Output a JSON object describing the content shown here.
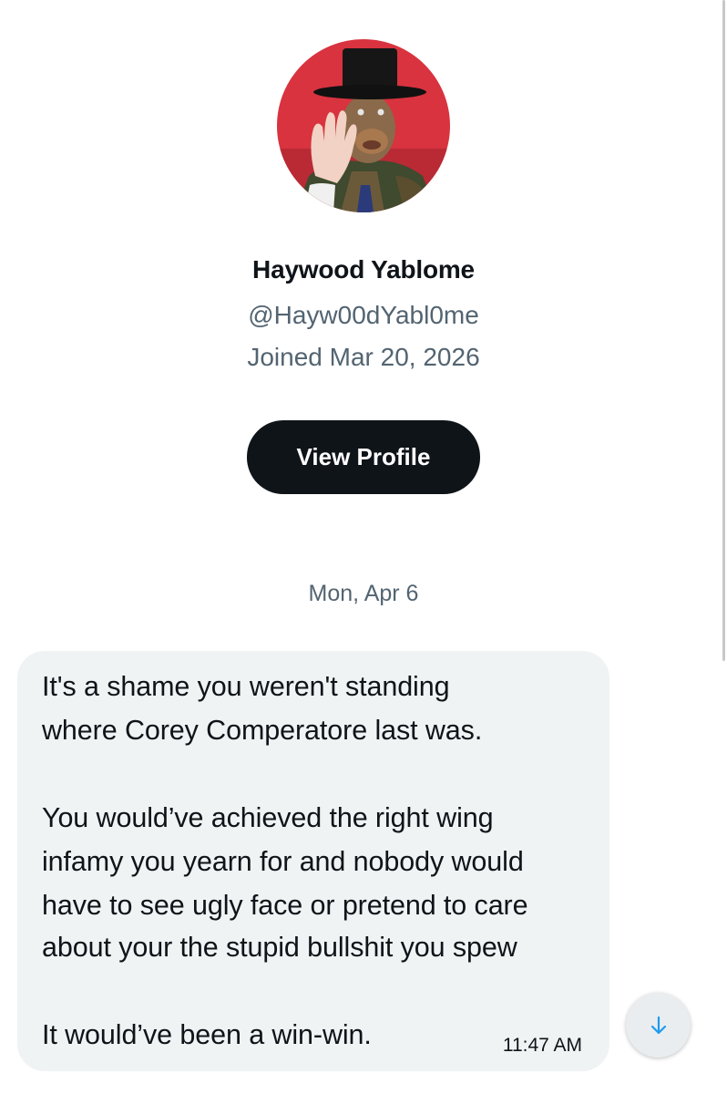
{
  "profile": {
    "name": "Haywood Yablome",
    "handle": "@Hayw00dYabl0me",
    "joined": "Joined Mar 20, 2026",
    "view_profile_label": "View Profile"
  },
  "conversation": {
    "date_divider": "Mon, Apr 6",
    "message": {
      "lines": [
        "It's a shame you weren't standing",
        "where Corey Comperatore last was.",
        "",
        "You would’ve achieved the right wing",
        "infamy you yearn for and nobody would",
        "have to see ugly face or pretend to care",
        "about your the stupid bullshit you spew",
        "",
        "It would’ve been a win-win."
      ],
      "time": "11:47 AM"
    }
  },
  "icons": {
    "scroll_down": "arrow-down-icon"
  },
  "colors": {
    "primary_text": "#0f1419",
    "secondary_text": "#536471",
    "bubble_background": "#eff3f4",
    "button_background": "#0f1419",
    "accent_blue": "#1d9bf0"
  }
}
